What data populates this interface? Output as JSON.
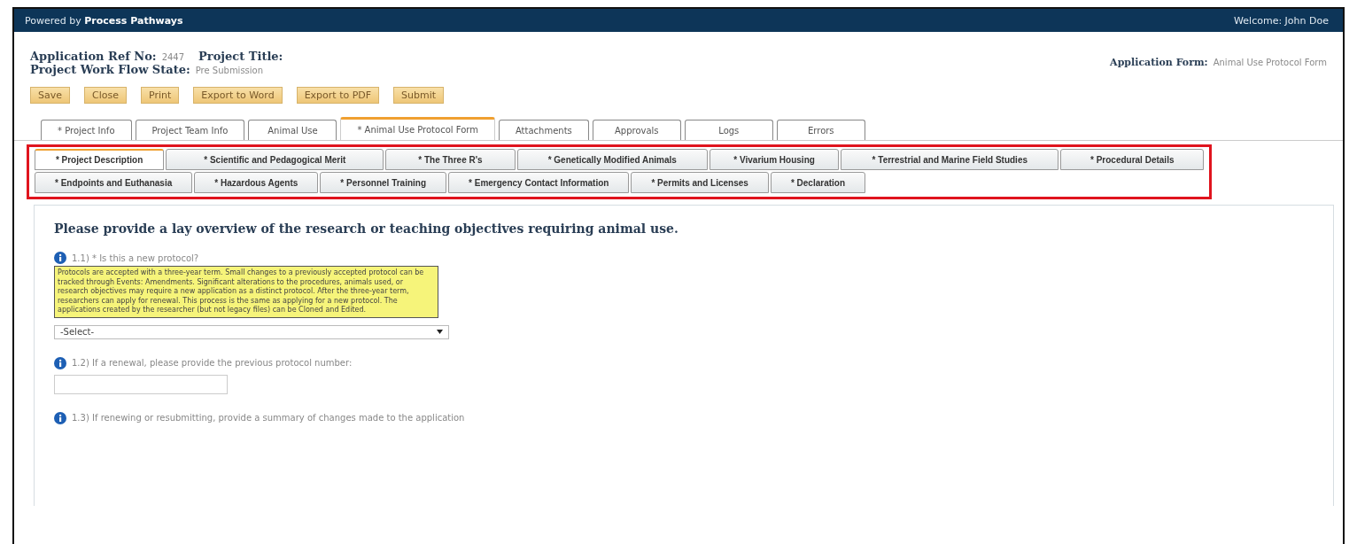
{
  "top_bar": {
    "powered_by": "Powered by **Process Pathways**",
    "welcome": "Welcome: John Doe"
  },
  "header": {
    "ref_label": "Application Ref No:",
    "ref_value": "2447",
    "title_label": "Project Title:",
    "state_label": "Project Work Flow State:",
    "state_value": "Pre Submission",
    "form_label": "Application Form:",
    "form_value": "Animal Use Protocol Form"
  },
  "buttons": [
    "Save",
    "Close",
    "Print",
    "Export to Word",
    "Export to PDF",
    "Submit"
  ],
  "tabs": [
    {
      "label": "* Project Info",
      "selected": false
    },
    {
      "label": "Project Team Info",
      "selected": false
    },
    {
      "label": "Animal Use",
      "selected": false
    },
    {
      "label": "* Animal Use Protocol Form",
      "selected": true
    },
    {
      "label": "Attachments",
      "selected": false
    },
    {
      "label": "Approvals",
      "selected": false
    },
    {
      "label": "Logs",
      "selected": false
    },
    {
      "label": "Errors",
      "selected": false
    }
  ],
  "sub_tabs": [
    [
      {
        "label": "* Project Description",
        "selected": true
      },
      {
        "label": "* Scientific and Pedagogical Merit",
        "selected": false
      },
      {
        "label": "* The Three R's",
        "selected": false
      },
      {
        "label": "* Genetically Modified Animals",
        "selected": false
      },
      {
        "label": "* Vivarium Housing",
        "selected": false
      },
      {
        "label": "* Terrestrial and Marine Field Studies",
        "selected": false
      },
      {
        "label": "* Procedural Details",
        "selected": false
      }
    ],
    [
      {
        "label": "* Endpoints and Euthanasia",
        "selected": false
      },
      {
        "label": "* Hazardous Agents",
        "selected": false
      },
      {
        "label": "* Personnel Training",
        "selected": false
      },
      {
        "label": "* Emergency Contact Information",
        "selected": false
      },
      {
        "label": "* Permits and Licenses",
        "selected": false
      },
      {
        "label": "* Declaration",
        "selected": false
      }
    ]
  ],
  "section_title": "Please provide a lay overview of the research or teaching objectives requiring animal use.",
  "questions": [
    {
      "kind": "select",
      "label": "1.1) * Is this a new protocol?",
      "help": "Protocols are accepted with a three-year term. Small changes to a previously accepted protocol can be tracked through Events: Amendments. Significant alterations to the procedures, animals used, or research objectives may require a new application as a distinct protocol. After the three-year term, researchers can apply for renewal. This process is the same as applying for a new protocol. The applications created by the researcher (but not legacy files) can be Cloned and Edited.",
      "value": "-Select-"
    },
    {
      "kind": "text",
      "label": "1.2) If a renewal, please provide the previous protocol number:"
    },
    {
      "kind": "none",
      "label": "1.3) If renewing or resubmitting, provide a summary of changes made to the application"
    }
  ]
}
